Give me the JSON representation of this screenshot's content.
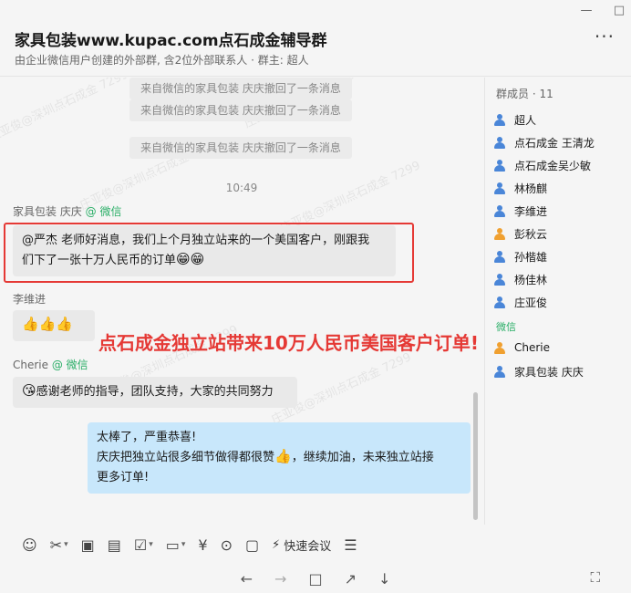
{
  "window": {
    "minimize": "—",
    "maximize": "□"
  },
  "header": {
    "title": "家具包装www.kupac.com点石成金辅导群",
    "subtitle": "由企业微信用户创建的外部群, 含2位外部联系人 · 群主: 超人",
    "more": "···"
  },
  "watermarks": [
    "庄亚俊@深圳点石成金 7299",
    "庄亚俊@深圳点石成金 7299",
    "庄亚俊@深圳点石成金 7299",
    "庄亚俊@深圳点石成金 7299",
    "庄亚俊@深圳点石成金 7299",
    "庄亚俊@深圳点石成金 7299"
  ],
  "chat": {
    "system_messages": [
      "来自微信的家具包装 庆庆撤回了一条消息",
      "来自微信的家具包装 庆庆撤回了一条消息",
      "来自微信的家具包装 庆庆撤回了一条消息"
    ],
    "time": "10:49",
    "msg1": {
      "sender": "家具包装 庆庆",
      "source": "@ 微信",
      "text_line1": "@严杰 老师好消息，我们上个月独立站来的一个美国客户，刚跟我",
      "text_line2": "们下了一张十万人民币的订单",
      "emoji": "😁😁"
    },
    "msg2": {
      "sender": "李维进",
      "emoji": "👍👍👍"
    },
    "msg3": {
      "sender": "Cherie",
      "source": "@ 微信",
      "emoji": "😘",
      "text": "感谢老师的指导，团队支持，大家的共同努力"
    },
    "msg4": {
      "line1": "太棒了，严重恭喜!",
      "line2a": "庆庆把独立站很多细节做得都很赞",
      "thumb": "👍",
      "line2b": "，继续加油，未来独立站接",
      "line3": "更多订单!"
    },
    "banner": "点石成金独立站带来10万人民币美国客户订单!"
  },
  "sidebar": {
    "member_count": "群成员 · 11",
    "members": [
      {
        "name": "超人"
      },
      {
        "name": "点石成金 王清龙"
      },
      {
        "name": "点石成金吴少敏"
      },
      {
        "name": "林杨麒"
      },
      {
        "name": "李维进"
      },
      {
        "name": "彭秋云"
      },
      {
        "name": "孙楷雄"
      },
      {
        "name": "杨佳林"
      },
      {
        "name": "庄亚俊"
      }
    ],
    "wechat_label": "微信",
    "wechat_members": [
      {
        "name": "Cherie"
      },
      {
        "name": "家具包装 庆庆"
      }
    ]
  },
  "toolbar": {
    "icons": [
      "emoji-icon",
      "scissors-icon",
      "image-icon",
      "file-icon",
      "checklist-icon",
      "folder-icon",
      "money-icon",
      "more-chat-icon",
      "comment-icon"
    ],
    "meeting_label": "快速会议"
  },
  "nav": {
    "back": "←",
    "forward": "→",
    "square": "□",
    "share": "↗",
    "download": "↓",
    "screenshot": "⛶"
  }
}
